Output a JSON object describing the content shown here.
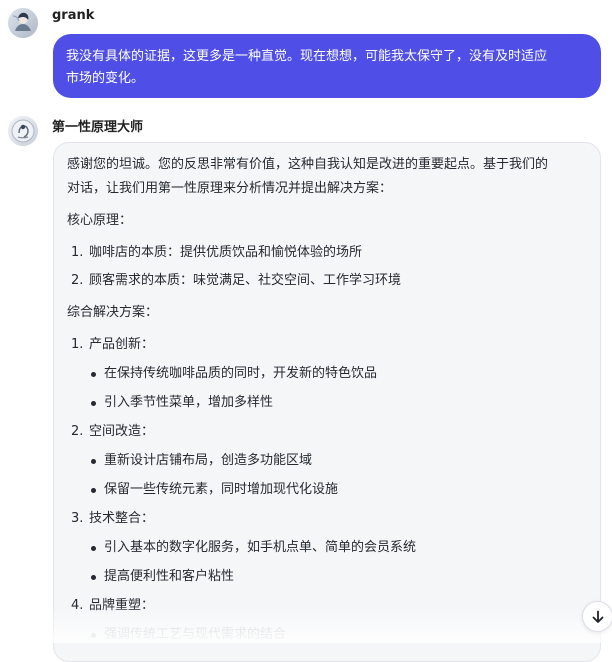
{
  "messages": {
    "user": {
      "name": "grank",
      "text_line_1": "我没有具体的证据，这更多是一种直觉。现在想想，可能我太保守了，没有及时适应",
      "text_line_2": "市场的变化。"
    },
    "assistant": {
      "name": "第一性原理大师",
      "intro_line_1": "感谢您的坦诚。您的反思非常有价值，这种自我认知是改进的重要起点。基于我们的",
      "intro_line_2": "对话，让我们用第一性原理来分析情况并提出解决方案：",
      "core_title": "核心原理：",
      "core_items": [
        "咖啡店的本质：提供优质饮品和愉悦体验的场所",
        "顾客需求的本质：味觉满足、社交空间、工作学习环境"
      ],
      "solution_title": "综合解决方案：",
      "solutions": [
        {
          "title": "产品创新：",
          "points": [
            "在保持传统咖啡品质的同时，开发新的特色饮品",
            "引入季节性菜单，增加多样性"
          ]
        },
        {
          "title": "空间改造：",
          "points": [
            "重新设计店铺布局，创造多功能区域",
            "保留一些传统元素，同时增加现代化设施"
          ]
        },
        {
          "title": "技术整合：",
          "points": [
            "引入基本的数字化服务，如手机点单、简单的会员系统",
            "提高便利性和客户粘性"
          ]
        },
        {
          "title": "品牌重塑：",
          "points": [
            "强调传统工艺与现代需求的结合"
          ]
        }
      ]
    }
  },
  "icons": {
    "scroll_down": "arrow-down-icon"
  }
}
